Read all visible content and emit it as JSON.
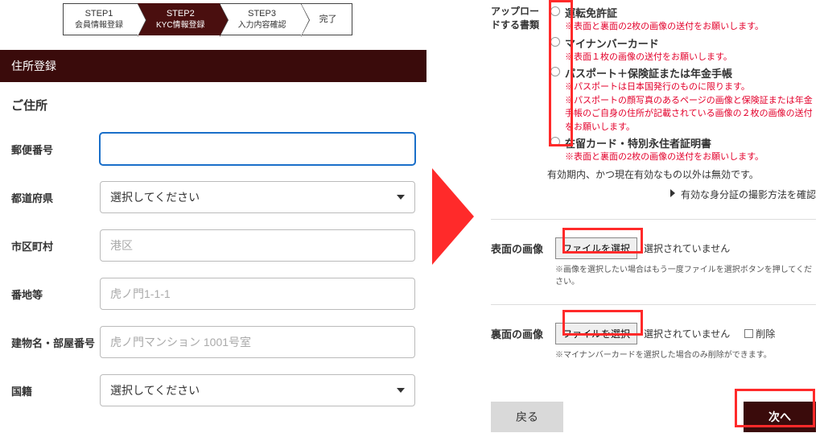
{
  "stepper": {
    "steps": [
      {
        "title": "STEP1",
        "sub": "会員情報登録"
      },
      {
        "title": "STEP2",
        "sub": "KYC情報登録"
      },
      {
        "title": "STEP3",
        "sub": "入力内容確認"
      },
      {
        "title": "完了",
        "sub": ""
      }
    ],
    "activeIndex": 1
  },
  "sectionBar": "住所登録",
  "sectionTitle": "ご住所",
  "form": {
    "postal": {
      "label": "郵便番号",
      "value": "",
      "placeholder": ""
    },
    "pref": {
      "label": "都道府県",
      "value": "",
      "placeholder": "選択してください"
    },
    "city": {
      "label": "市区町村",
      "value": "",
      "placeholder": "港区"
    },
    "street": {
      "label": "番地等",
      "value": "",
      "placeholder": "虎ノ門1-1-1"
    },
    "building": {
      "label": "建物名・部屋番号",
      "value": "",
      "placeholder": "虎ノ門マンション 1001号室"
    },
    "country": {
      "label": "国籍",
      "value": "",
      "placeholder": "選択してください"
    }
  },
  "docs": {
    "leftLabel": "アップロードする書類",
    "items": [
      {
        "name": "運転免許証",
        "notes": [
          "※表面と裏面の2枚の画像の送付をお願いします。"
        ]
      },
      {
        "name": "マイナンバーカード",
        "notes": [
          "※表面１枚の画像の送付をお願いします。"
        ]
      },
      {
        "name": "パスポート＋保険証または年金手帳",
        "notes": [
          "※パスポートは日本国発行のものに限ります。",
          "※パスポートの顔写真のあるページの画像と保険証または年金手帳のご自身の住所が記載されている画像の２枚の画像の送付をお願いします。"
        ]
      },
      {
        "name": "在留カード・特別永住者証明書",
        "notes": [
          "※表面と裏面の2枚の画像の送付をお願いします。"
        ]
      }
    ],
    "validity": "有効期内、かつ現在有効なもの以外は無効です。",
    "shootLink": "有効な身分証の撮影方法を確認"
  },
  "uploads": {
    "front": {
      "label": "表面の画像",
      "button": "ファイルを選択",
      "status": "選択されていません",
      "note": "※画像を選択したい場合はもう一度ファイルを選択ボタンを押してください。"
    },
    "back": {
      "label": "裏面の画像",
      "button": "ファイルを選択",
      "status": "選択されていません",
      "note": "※マイナンバーカードを選択した場合のみ削除ができます。",
      "deleteLabel": "削除"
    }
  },
  "buttons": {
    "back": "戻る",
    "next": "次へ"
  },
  "highlightColor": "#ff2a2a"
}
